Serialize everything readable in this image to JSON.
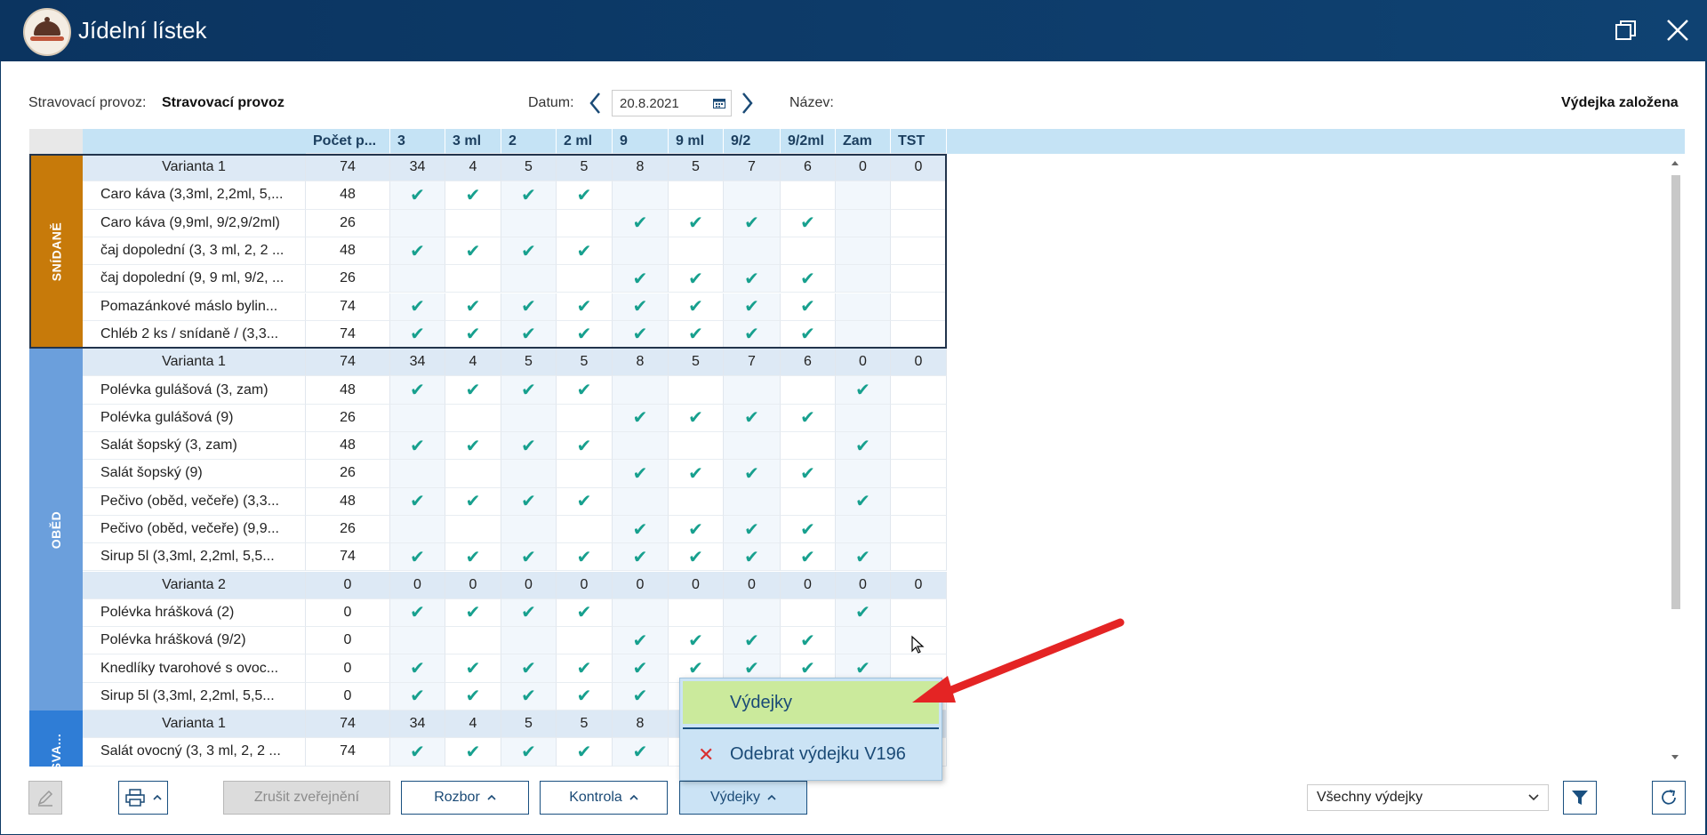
{
  "window": {
    "title": "Jídelní lístek"
  },
  "info": {
    "provoz_label": "Stravovací provoz:",
    "provoz_value": "Stravovací provoz",
    "datum_label": "Datum:",
    "datum_value": "20.8.2021",
    "nazev_label": "Název:",
    "status": "Výdejka založena"
  },
  "columns": [
    "Počet p...",
    "3",
    "3 ml",
    "2",
    "2 ml",
    "9",
    "9 ml",
    "9/2",
    "9/2ml",
    "Zam",
    "TST"
  ],
  "sections": [
    {
      "label": "SNÍDANĚ",
      "color": "#c77a0a",
      "row_start": 0,
      "row_count": 7
    },
    {
      "label": "OBĚD",
      "color": "#6b9fdc",
      "row_start": 7,
      "row_count": 13
    },
    {
      "label": "SVA...",
      "color": "#2f7dd6",
      "row_start": 20,
      "row_count": 3
    }
  ],
  "rows": [
    {
      "type": "variant",
      "name": "Varianta 1",
      "count": "74",
      "vals": [
        "34",
        "4",
        "5",
        "5",
        "8",
        "5",
        "7",
        "6",
        "0",
        "0"
      ]
    },
    {
      "type": "item",
      "name": "Caro káva (3,3ml,  2,2ml, 5,...",
      "count": "48",
      "checks": [
        1,
        1,
        1,
        1,
        0,
        0,
        0,
        0,
        0,
        0
      ]
    },
    {
      "type": "item",
      "name": "Caro káva (9,9ml, 9/2,9/2ml)",
      "count": "26",
      "checks": [
        0,
        0,
        0,
        0,
        1,
        1,
        1,
        1,
        0,
        0
      ]
    },
    {
      "type": "item",
      "name": "čaj dopolední (3, 3 ml, 2, 2 ...",
      "count": "48",
      "checks": [
        1,
        1,
        1,
        1,
        0,
        0,
        0,
        0,
        0,
        0
      ]
    },
    {
      "type": "item",
      "name": "čaj dopolední (9, 9 ml, 9/2, ...",
      "count": "26",
      "checks": [
        0,
        0,
        0,
        0,
        1,
        1,
        1,
        1,
        0,
        0
      ]
    },
    {
      "type": "item",
      "name": "Pomazánkové máslo bylin...",
      "count": "74",
      "checks": [
        1,
        1,
        1,
        1,
        1,
        1,
        1,
        1,
        0,
        0
      ]
    },
    {
      "type": "item",
      "name": "Chléb 2 ks / snídaně / (3,3...",
      "count": "74",
      "checks": [
        1,
        1,
        1,
        1,
        1,
        1,
        1,
        1,
        0,
        0
      ]
    },
    {
      "type": "variant",
      "name": "Varianta 1",
      "count": "74",
      "vals": [
        "34",
        "4",
        "5",
        "5",
        "8",
        "5",
        "7",
        "6",
        "0",
        "0"
      ]
    },
    {
      "type": "item",
      "name": "Polévka gulášová (3, zam)",
      "count": "48",
      "checks": [
        1,
        1,
        1,
        1,
        0,
        0,
        0,
        0,
        1,
        0
      ]
    },
    {
      "type": "item",
      "name": "Polévka gulášová (9)",
      "count": "26",
      "checks": [
        0,
        0,
        0,
        0,
        1,
        1,
        1,
        1,
        0,
        0
      ]
    },
    {
      "type": "item",
      "name": "Salát šopský (3, zam)",
      "count": "48",
      "checks": [
        1,
        1,
        1,
        1,
        0,
        0,
        0,
        0,
        1,
        0
      ]
    },
    {
      "type": "item",
      "name": "Salát šopský (9)",
      "count": "26",
      "checks": [
        0,
        0,
        0,
        0,
        1,
        1,
        1,
        1,
        0,
        0
      ]
    },
    {
      "type": "item",
      "name": "Pečivo (oběd, večeře) (3,3...",
      "count": "48",
      "checks": [
        1,
        1,
        1,
        1,
        0,
        0,
        0,
        0,
        1,
        0
      ]
    },
    {
      "type": "item",
      "name": "Pečivo (oběd, večeře) (9,9...",
      "count": "26",
      "checks": [
        0,
        0,
        0,
        0,
        1,
        1,
        1,
        1,
        0,
        0
      ]
    },
    {
      "type": "item",
      "name": "Sirup 5l (3,3ml,  2,2ml, 5,5...",
      "count": "74",
      "checks": [
        1,
        1,
        1,
        1,
        1,
        1,
        1,
        1,
        1,
        0
      ]
    },
    {
      "type": "variant",
      "name": "Varianta 2",
      "count": "0",
      "vals": [
        "0",
        "0",
        "0",
        "0",
        "0",
        "0",
        "0",
        "0",
        "0",
        "0"
      ]
    },
    {
      "type": "item",
      "name": "Polévka hrášková (2)",
      "count": "0",
      "checks": [
        1,
        1,
        1,
        1,
        0,
        0,
        0,
        0,
        1,
        0
      ]
    },
    {
      "type": "item",
      "name": "Polévka hrášková (9/2)",
      "count": "0",
      "checks": [
        0,
        0,
        0,
        0,
        1,
        1,
        1,
        1,
        0,
        0
      ]
    },
    {
      "type": "item",
      "name": "Knedlíky tvarohové s ovoc...",
      "count": "0",
      "checks": [
        1,
        1,
        1,
        1,
        1,
        1,
        1,
        1,
        1,
        0
      ]
    },
    {
      "type": "item",
      "name": "Sirup 5l (3,3ml,  2,2ml, 5,5...",
      "count": "0",
      "checks": [
        1,
        1,
        1,
        1,
        1,
        0,
        0,
        0,
        0,
        0
      ]
    },
    {
      "type": "variant",
      "name": "Varianta 1",
      "count": "74",
      "vals": [
        "34",
        "4",
        "5",
        "5",
        "8",
        "",
        "",
        "",
        "",
        ""
      ]
    },
    {
      "type": "item",
      "name": "Salát ovocný (3, 3 ml, 2, 2 ...",
      "count": "74",
      "checks": [
        1,
        1,
        1,
        1,
        1,
        0,
        0,
        0,
        0,
        0
      ]
    }
  ],
  "toolbar": {
    "zrusit": "Zrušit zveřejnění",
    "rozbor": "Rozbor",
    "kontrola": "Kontrola",
    "vydejky": "Výdejky",
    "filter_value": "Všechny výdejky"
  },
  "popup": {
    "item1": "Výdejky",
    "item2": "Odebrat výdejku V196"
  },
  "colors": {
    "accent": "#1a5080",
    "check": "#17a08e",
    "header": "#c5e3f5"
  }
}
